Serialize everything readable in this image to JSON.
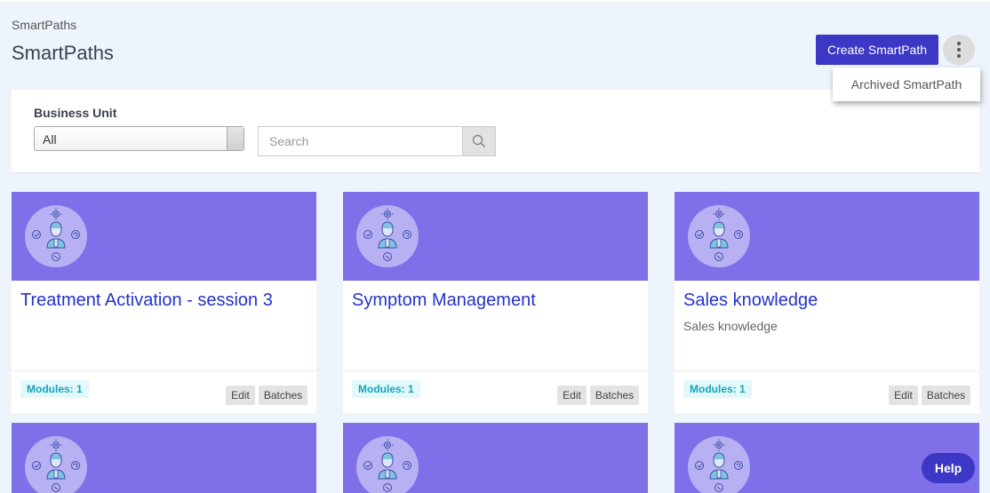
{
  "breadcrumb": "SmartPaths",
  "title": "SmartPaths",
  "header": {
    "create_label": "Create SmartPath",
    "menu_items": [
      "Archived SmartPath"
    ]
  },
  "filters": {
    "business_unit_label": "Business Unit",
    "business_unit_value": "All",
    "search_placeholder": "Search"
  },
  "cards": [
    {
      "title": "Treatment Activation - session 3",
      "description": "",
      "modules": "Modules: 1",
      "edit": "Edit",
      "batches": "Batches"
    },
    {
      "title": "Symptom Management",
      "description": "",
      "modules": "Modules: 1",
      "edit": "Edit",
      "batches": "Batches"
    },
    {
      "title": "Sales knowledge",
      "description": "Sales knowledge",
      "modules": "Modules: 1",
      "edit": "Edit",
      "batches": "Batches"
    }
  ],
  "help_label": "Help",
  "colors": {
    "primary": "#3c37c4",
    "banner": "#7f6fe8",
    "link": "#2433c9",
    "badge_text": "#14a6bd"
  }
}
